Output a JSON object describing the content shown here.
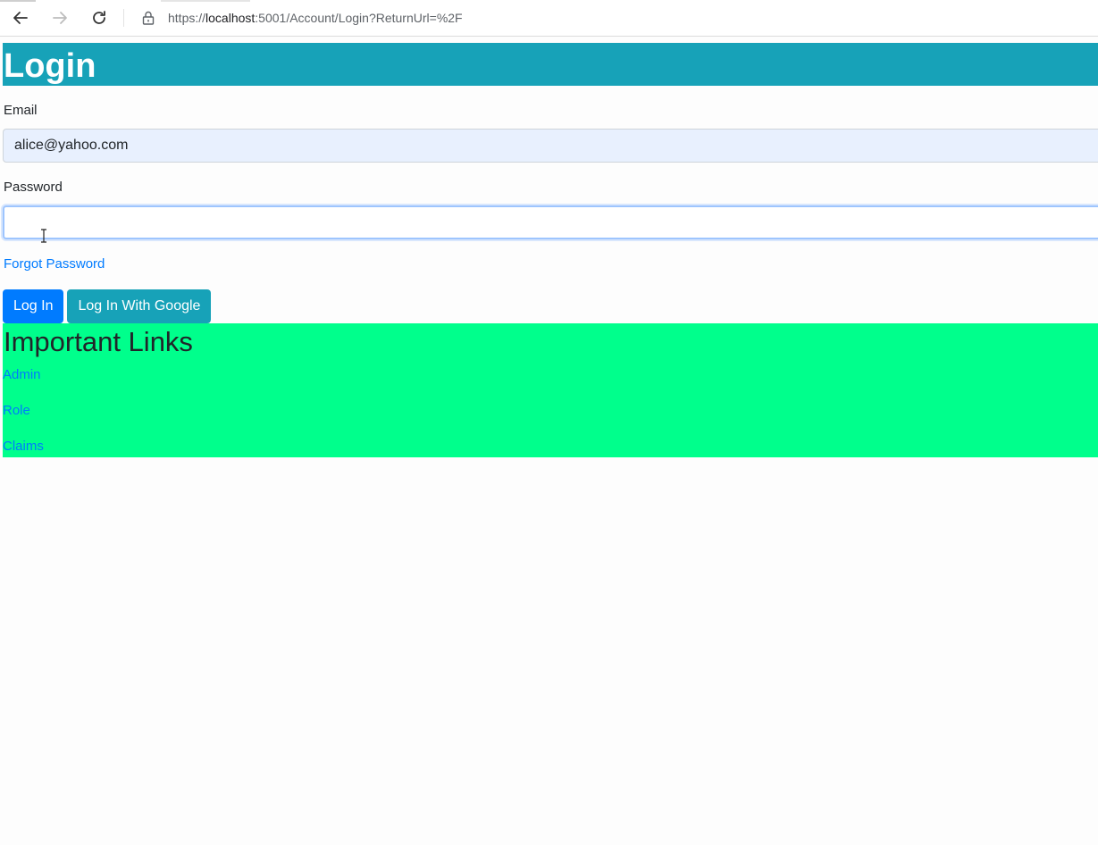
{
  "browser": {
    "url_prefix": "https://",
    "url_host": "localhost",
    "url_rest": ":5001/Account/Login?ReturnUrl=%2F"
  },
  "page": {
    "title": "Login",
    "email": {
      "label": "Email",
      "value": "alice@yahoo.com"
    },
    "password": {
      "label": "Password",
      "value": ""
    },
    "forgot_password": "Forgot Password",
    "buttons": {
      "login": "Log In",
      "login_google": "Log In With Google"
    },
    "links_section": {
      "title": "Important Links",
      "items": [
        {
          "label": "Admin"
        },
        {
          "label": "Role"
        },
        {
          "label": "Claims"
        }
      ]
    }
  },
  "colors": {
    "header_bg": "#17a2b8",
    "primary": "#007bff",
    "info": "#17a2b8",
    "links_bg": "#00ff8c"
  },
  "icons": {
    "back": "arrow-left-icon",
    "forward": "arrow-right-icon",
    "reload": "reload-icon",
    "lock": "lock-icon",
    "text_cursor": "text-cursor-icon"
  }
}
